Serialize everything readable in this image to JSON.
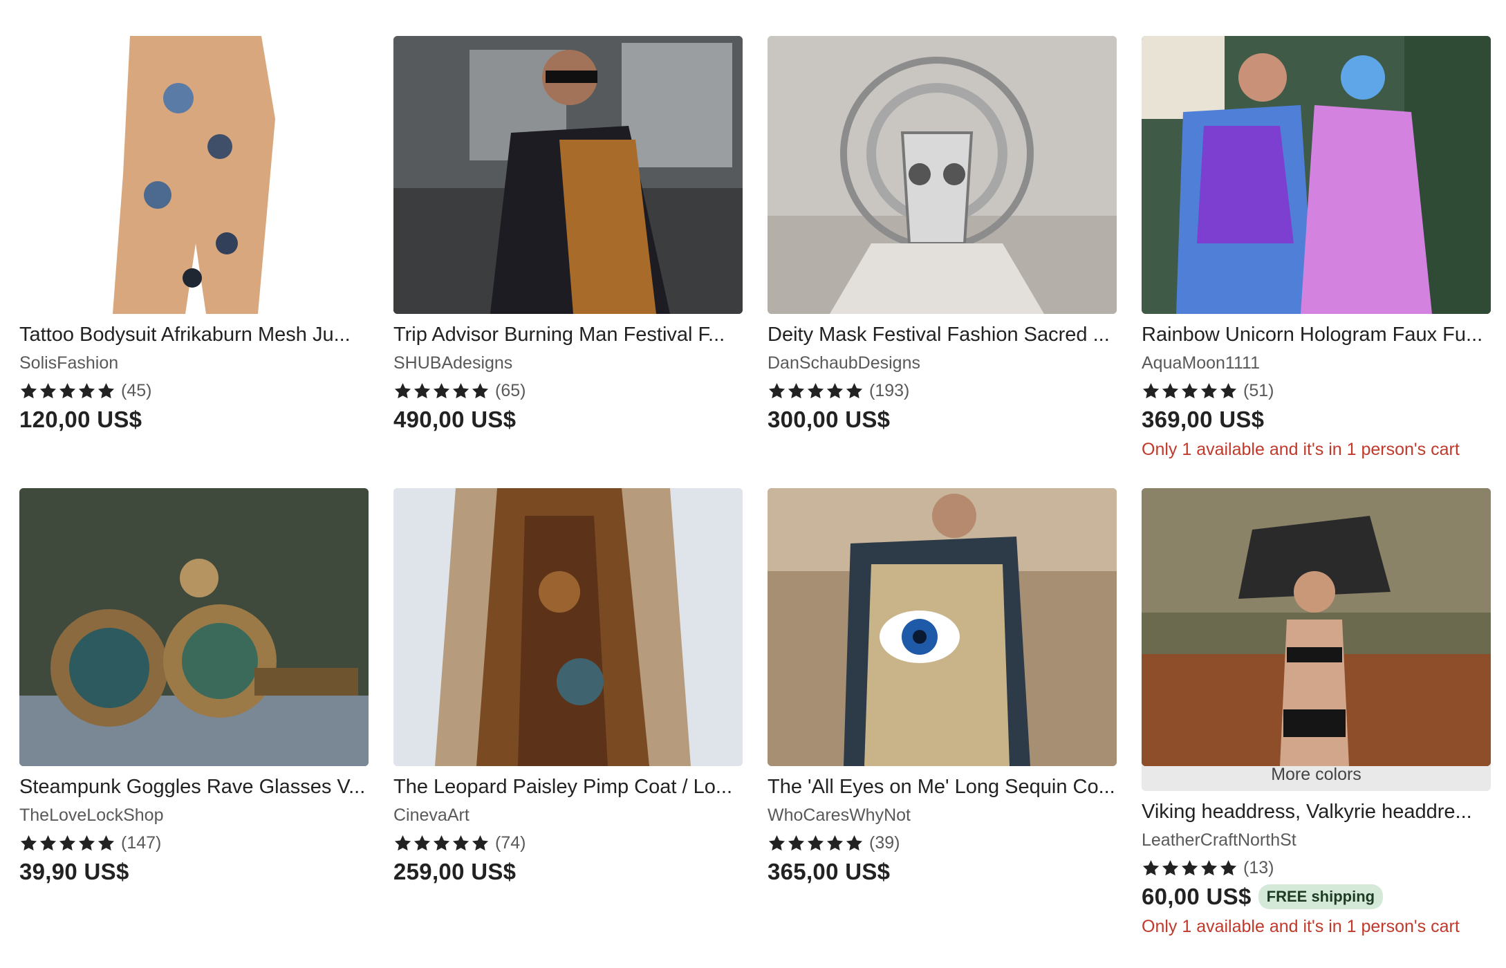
{
  "listings": [
    {
      "title": "Tattoo Bodysuit Afrikaburn Mesh Ju...",
      "shop": "SolisFashion",
      "rating_count": "(45)",
      "price": "120,00 US$",
      "stock_note": "",
      "more_colors": "",
      "badge": "",
      "image": "tattoo-bodysuit-photo"
    },
    {
      "title": "Trip Advisor Burning Man Festival F...",
      "shop": "SHUBAdesigns",
      "rating_count": "(65)",
      "price": "490,00 US$",
      "stock_note": "",
      "more_colors": "",
      "badge": "",
      "image": "festival-coat-photo"
    },
    {
      "title": "Deity Mask Festival Fashion Sacred ...",
      "shop": "DanSchaubDesigns",
      "rating_count": "(193)",
      "price": "300,00 US$",
      "stock_note": "",
      "more_colors": "",
      "badge": "",
      "image": "deity-mask-photo"
    },
    {
      "title": "Rainbow Unicorn Hologram Faux Fu...",
      "shop": "AquaMoon1111",
      "rating_count": "(51)",
      "price": "369,00 US$",
      "stock_note": "Only 1 available and it's in 1 person's cart",
      "more_colors": "",
      "badge": "",
      "image": "rainbow-fur-coat-photo"
    },
    {
      "title": "Steampunk Goggles Rave Glasses V...",
      "shop": "TheLoveLockShop",
      "rating_count": "(147)",
      "price": "39,90 US$",
      "stock_note": "",
      "more_colors": "",
      "badge": "",
      "image": "steampunk-goggles-photo"
    },
    {
      "title": "The Leopard Paisley Pimp Coat / Lo...",
      "shop": "CinevaArt",
      "rating_count": "(74)",
      "price": "259,00 US$",
      "stock_note": "",
      "more_colors": "",
      "badge": "",
      "image": "paisley-coat-photo"
    },
    {
      "title": "The 'All Eyes on Me' Long Sequin Co...",
      "shop": "WhoCaresWhyNot",
      "rating_count": "(39)",
      "price": "365,00 US$",
      "stock_note": "",
      "more_colors": "",
      "badge": "",
      "image": "sequin-coat-photo"
    },
    {
      "title": "Viking headdress, Valkyrie headdre...",
      "shop": "LeatherCraftNorthSt",
      "rating_count": "(13)",
      "price": "60,00 US$",
      "stock_note": "Only 1 available and it's in 1 person's cart",
      "more_colors": "More colors",
      "badge": "FREE shipping",
      "image": "feather-headdress-photo"
    }
  ],
  "rating_stars": 5,
  "colors": {
    "stock_note": "#c0392b",
    "badge_bg": "#d4e9d7",
    "text": "#222222",
    "muted": "#595959"
  }
}
